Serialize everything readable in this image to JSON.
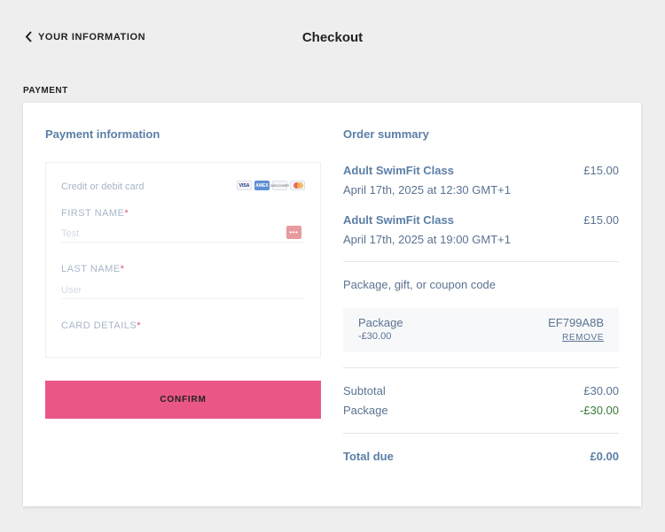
{
  "header": {
    "back_label": "YOUR INFORMATION",
    "title": "Checkout"
  },
  "section_label": "PAYMENT",
  "payment": {
    "title": "Payment information",
    "card_type_label": "Credit or debit card",
    "brands": [
      "VISA",
      "AMEX",
      "DISCOVER",
      "mastercard"
    ],
    "first_name_label": "FIRST NAME",
    "first_name_placeholder": "Test",
    "last_name_label": "LAST NAME",
    "last_name_placeholder": "User",
    "card_details_label": "CARD DETAILS",
    "required_mark": "*",
    "confirm_label": "CONFIRM"
  },
  "summary": {
    "title": "Order summary",
    "items": [
      {
        "name": "Adult SwimFit Class",
        "price": "£15.00",
        "date": "April 17th, 2025 at 12:30 GMT+1"
      },
      {
        "name": "Adult SwimFit Class",
        "price": "£15.00",
        "date": "April 17th, 2025 at 19:00 GMT+1"
      }
    ],
    "coupon_label": "Package, gift, or coupon code",
    "package": {
      "name": "Package",
      "amount": "-£30.00",
      "code": "EF799A8B",
      "remove_label": "REMOVE"
    },
    "subtotal_label": "Subtotal",
    "subtotal_value": "£30.00",
    "package_label": "Package",
    "package_value": "-£30.00",
    "total_label": "Total due",
    "total_value": "£0.00"
  },
  "colors": {
    "accent": "#ea5786",
    "title_blue": "#5b7fa6",
    "discount_green": "#3d7a3d"
  }
}
